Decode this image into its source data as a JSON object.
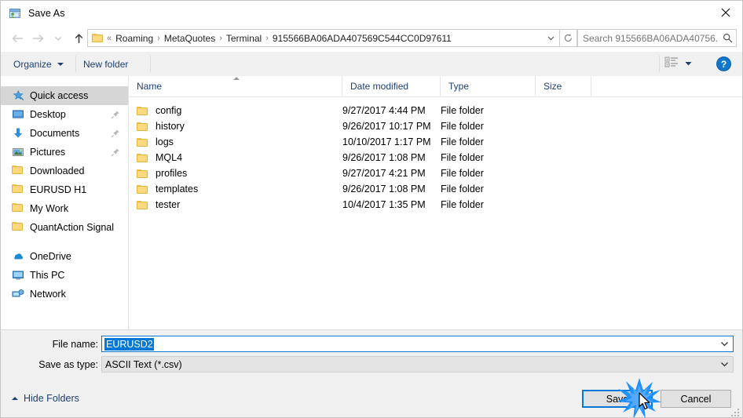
{
  "window": {
    "title": "Save As",
    "icon": "save-as-icon",
    "close_label": "×"
  },
  "nav": {
    "back": "back-arrow",
    "forward": "forward-arrow",
    "recent": "recent-locations-chevron",
    "up": "up-arrow",
    "breadcrumbs": [
      "Roaming",
      "MetaQuotes",
      "Terminal",
      "915566BA06ADA407569C544CC0D97611"
    ],
    "breadcrumb_overflow": "«",
    "separator": "›",
    "refresh": "refresh-icon",
    "dropdown": "chevron-down-icon"
  },
  "search": {
    "placeholder": "Search 915566BA06ADA40756...",
    "value": "",
    "icon": "search-icon"
  },
  "toolbar": {
    "organize_label": "Organize",
    "new_folder_label": "New folder",
    "view_icon": "view-layout-icon",
    "view_dropdown_icon": "chevron-down-icon",
    "help_icon": "help-icon",
    "help_label": "?"
  },
  "sidebar": {
    "quick_access": {
      "label": "Quick access",
      "icon": "star-pin-icon",
      "selected": true
    },
    "pinned": [
      {
        "label": "Desktop",
        "icon": "desktop-icon",
        "pinned": true
      },
      {
        "label": "Documents",
        "icon": "documents-icon",
        "pinned": true
      },
      {
        "label": "Pictures",
        "icon": "pictures-icon",
        "pinned": true
      },
      {
        "label": "Downloaded",
        "icon": "folder-icon",
        "pinned": false
      },
      {
        "label": "EURUSD H1",
        "icon": "folder-icon",
        "pinned": false
      },
      {
        "label": "My Work",
        "icon": "folder-icon",
        "pinned": false
      },
      {
        "label": "QuantAction Signal",
        "icon": "folder-icon",
        "pinned": false
      }
    ],
    "roots": [
      {
        "label": "OneDrive",
        "icon": "onedrive-icon"
      },
      {
        "label": "This PC",
        "icon": "this-pc-icon"
      },
      {
        "label": "Network",
        "icon": "network-icon"
      }
    ]
  },
  "filelist": {
    "columns": [
      {
        "label": "Name",
        "sorted": "asc"
      },
      {
        "label": "Date modified",
        "sorted": null
      },
      {
        "label": "Type",
        "sorted": null
      },
      {
        "label": "Size",
        "sorted": null
      }
    ],
    "rows": [
      {
        "name": "config",
        "date": "9/27/2017 4:44 PM",
        "type": "File folder",
        "size": "",
        "icon": "folder-icon"
      },
      {
        "name": "history",
        "date": "9/26/2017 10:17 PM",
        "type": "File folder",
        "size": "",
        "icon": "folder-icon"
      },
      {
        "name": "logs",
        "date": "10/10/2017 1:17 PM",
        "type": "File folder",
        "size": "",
        "icon": "folder-icon"
      },
      {
        "name": "MQL4",
        "date": "9/26/2017 1:08 PM",
        "type": "File folder",
        "size": "",
        "icon": "folder-icon"
      },
      {
        "name": "profiles",
        "date": "9/27/2017 4:21 PM",
        "type": "File folder",
        "size": "",
        "icon": "folder-icon"
      },
      {
        "name": "templates",
        "date": "9/26/2017 1:08 PM",
        "type": "File folder",
        "size": "",
        "icon": "folder-icon"
      },
      {
        "name": "tester",
        "date": "10/4/2017 1:35 PM",
        "type": "File folder",
        "size": "",
        "icon": "folder-icon"
      }
    ]
  },
  "form": {
    "filename_label": "File name:",
    "filename_value": "EURUSD2",
    "filetype_label": "Save as type:",
    "filetype_value": "ASCII Text (*.csv)",
    "chevron_icon": "chevron-down-icon"
  },
  "footer": {
    "hide_folders_label": "Hide Folders",
    "save_label": "Save",
    "cancel_label": "Cancel",
    "click_indicator": "click-burst",
    "cursor": "mouse-pointer"
  },
  "colors": {
    "accent": "#0078d7",
    "link_text": "#1c3f75",
    "folder_fill": "#fbd97c",
    "selection": "#d6d6d6",
    "chrome": "#f0f0f0"
  }
}
